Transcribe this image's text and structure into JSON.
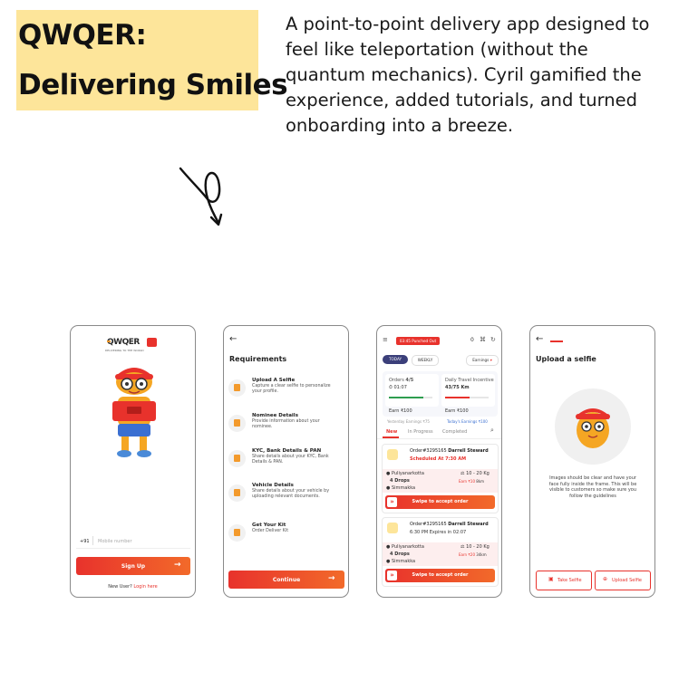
{
  "heading": {
    "line1": "QWQER:",
    "line2": "Delivering Smiles"
  },
  "description": "A point-to-point delivery app designed to feel like teleportation (without the quantum mechanics). Cyril gamified the experience, added tutorials, and turned onboarding into a breeze.",
  "screen1": {
    "logo": "QWQER",
    "tagline": "DELIVERING TO THE WORLD",
    "country_code": "+91",
    "phone_placeholder": "Mobile number",
    "signup_label": "Sign Up",
    "new_user_text": "New User?",
    "login_link": "Login here"
  },
  "screen2": {
    "title": "Requirements",
    "items": [
      {
        "title": "Upload A Selfie",
        "desc": "Capture a clear selfie to personalize your profile."
      },
      {
        "title": "Nominee Details",
        "desc": "Provide information about your nominee."
      },
      {
        "title": "KYC, Bank Details & PAN",
        "desc": "Share details about your KYC, Bank Details & PAN."
      },
      {
        "title": "Vehicle Details",
        "desc": "Share details about your vehicle by uploading relevant documents."
      },
      {
        "title": "Get Your Kit",
        "desc": "Order Deliver Kit"
      }
    ],
    "continue_label": "Continue"
  },
  "screen3": {
    "punch_badge": "03:45 Punched Out",
    "header_count": "0",
    "tabs": {
      "today": "TODAY",
      "weekly": "WEEKLY",
      "earnings": "Earnings"
    },
    "orders_label": "Orders",
    "orders_value": "4/5",
    "orders_time": "01:07",
    "incentive_label": "Daily Travel Incentive",
    "incentive_value": "43/75 Km",
    "earn_left": "Earn ₹100",
    "earn_right": "Earn ₹100",
    "yesterday": "Yesterday Earnings ₹75",
    "today_earnings": "Today's Earnings ₹100",
    "order_tabs": [
      "New",
      "In Progress",
      "Completed"
    ],
    "orders": [
      {
        "id": "Order#3295165",
        "name": "Darrell Steward",
        "schedule": "Scheduled At 7:30 AM",
        "weight": "10 - 20 Kg",
        "from": "Puliyanarkotta",
        "drops": "4 Drops",
        "to": "Simmakka",
        "earn": "Earn ₹10",
        "dist": "8km",
        "swipe": "Swipe to accept order"
      },
      {
        "id": "Order#3295165",
        "name": "Darrell Steward",
        "schedule": "6:30 PM  Expires in  02:07",
        "weight": "10 - 20 Kg",
        "from": "Puliyanarkotta",
        "drops": "4 Drops",
        "to": "Simmakka",
        "earn": "Earn ₹20",
        "dist": "34km",
        "swipe": "Swipe to accept order"
      }
    ]
  },
  "screen4": {
    "title": "Upload a selfie",
    "instructions": "Images should be clear and have your face fully inside the frame. This will be visible to customers so make sure you follow the guidelines",
    "take_selfie": "Take Selfie",
    "upload_selfie": "Upload Selfie"
  },
  "colors": {
    "accent": "#e8322c",
    "highlight": "#fde59a",
    "navy": "#3b3f7a"
  }
}
